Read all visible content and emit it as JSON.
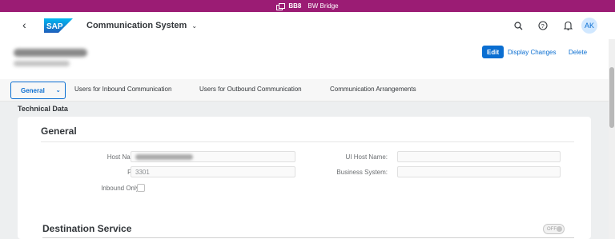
{
  "system_bar": {
    "system_id": "BB8",
    "system_name": "BW Bridge",
    "color": "#9b1c74"
  },
  "shell": {
    "logo_text": "SAP",
    "app_title": "Communication System",
    "avatar_initials": "AK",
    "icons": [
      "back-icon",
      "search-icon",
      "help-icon",
      "bell-icon"
    ]
  },
  "header": {
    "edit_label": "Edit",
    "display_changes_label": "Display Changes",
    "delete_label": "Delete"
  },
  "tabs": {
    "general": "General",
    "inbound": "Users for Inbound Communication",
    "outbound": "Users for Outbound Communication",
    "arrangements": "Communication Arrangements"
  },
  "section": {
    "title": "Technical Data"
  },
  "general": {
    "title": "General",
    "host_name_label": "Host Name:",
    "port_label": "Port:",
    "port_value": "3301",
    "inbound_only_label": "Inbound Only:",
    "ui_host_name_label": "UI Host Name:",
    "business_system_label": "Business System:"
  },
  "destination": {
    "title": "Destination Service",
    "toggle_label": "OFF"
  },
  "colors": {
    "accent": "#0a6ed1",
    "background": "#edeff0"
  }
}
